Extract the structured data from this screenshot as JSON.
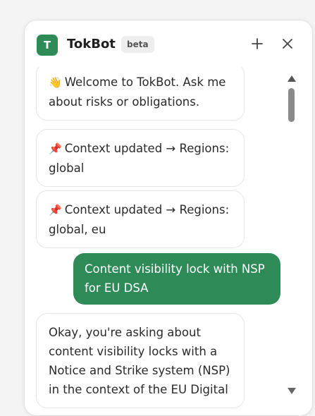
{
  "header": {
    "logo_letter": "T",
    "title": "TokBot",
    "badge": "beta",
    "add_icon": "plus-icon",
    "close_icon": "close-icon"
  },
  "messages": [
    {
      "role": "bot",
      "icon": "👋",
      "text": "Welcome to TokBot. Ask me about risks or obligations."
    },
    {
      "role": "bot",
      "icon": "📌",
      "text": "Context updated → Regions: global"
    },
    {
      "role": "bot",
      "icon": "📌",
      "text": "Context updated → Regions: global, eu"
    },
    {
      "role": "user",
      "text": "Content visibility lock with NSP for EU DSA"
    },
    {
      "role": "bot",
      "text": "Okay, you're asking about content visibility locks with a Notice and Strike system (NSP) in the context of the EU Digital"
    }
  ],
  "colors": {
    "accent": "#2e8b57",
    "bubble_border": "#e6e6e6"
  }
}
